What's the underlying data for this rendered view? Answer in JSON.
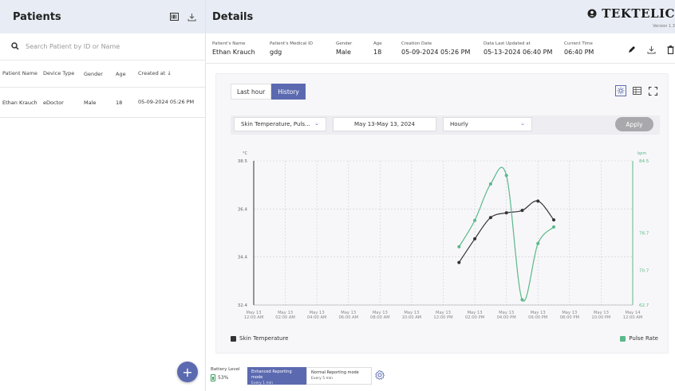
{
  "patients_panel": {
    "title": "Patients",
    "search_placeholder": "Search Patient by ID or Name",
    "columns": [
      "Patient Name",
      "Device Type",
      "Gender",
      "Age",
      "Created at ↓"
    ],
    "rows": [
      {
        "name": "Ethan Krauch",
        "device": "eDoctor",
        "gender": "Male",
        "age": "18",
        "created": "05-09-2024 05:26 PM"
      }
    ],
    "add_label": "+"
  },
  "details": {
    "title": "Details",
    "brand": "TEKTELIC",
    "version": "Version 1.3",
    "fields": [
      {
        "label": "Patient's Name",
        "value": "Ethan Krauch"
      },
      {
        "label": "Patient's Medical ID",
        "value": "gdg"
      },
      {
        "label": "Gender",
        "value": "Male"
      },
      {
        "label": "Age",
        "value": "18"
      },
      {
        "label": "Creation Date",
        "value": "05-09-2024 05:26 PM"
      },
      {
        "label": "Data Last Updated at",
        "value": "05-13-2024 06:40 PM"
      },
      {
        "label": "Current Time",
        "value": "06:40 PM"
      }
    ]
  },
  "chart_controls": {
    "tabs": [
      "Last hour",
      "History"
    ],
    "active_tab": "History",
    "metric_select": "Skin Temperature, Puls...",
    "date_range": "May 13-May 13, 2024",
    "interval_select": "Hourly",
    "apply_label": "Apply"
  },
  "bottom_bar": {
    "battery_label": "Battery Level",
    "battery_value": "53%",
    "enhanced_mode": "Enhanced Reporting mode",
    "enhanced_sub": "Every 1 min",
    "normal_mode": "Normal Reporting mode",
    "normal_sub": "Every 5 min"
  },
  "colors": {
    "accent": "#5b6ab0",
    "skin_temp": "#333333",
    "pulse": "#5bb88a"
  },
  "chart_data": {
    "type": "line",
    "x": [
      "May 13 12:00 AM",
      "May 13 02:00 AM",
      "May 13 04:00 AM",
      "May 13 06:00 AM",
      "May 13 08:00 AM",
      "May 13 10:00 AM",
      "May 13 12:00 PM",
      "May 13 02:00 PM",
      "May 13 04:00 PM",
      "May 13 06:00 PM",
      "May 13 08:00 PM",
      "May 13 10:00 PM",
      "May 14 12:00 AM"
    ],
    "left_axis": {
      "unit": "°C",
      "ticks": [
        "38.5",
        "36.4",
        "34.4",
        "32.4"
      ],
      "range": [
        32.4,
        38.5
      ]
    },
    "right_axis": {
      "unit": "bpm",
      "ticks": [
        "84.5",
        "78.7",
        "70.7",
        "62.7"
      ],
      "range": [
        62.7,
        84.5
      ]
    },
    "series": [
      {
        "name": "Skin Temperature",
        "axis": "left",
        "hours": [
          13,
          14,
          15,
          16,
          17,
          18,
          19
        ],
        "values": [
          34.2,
          35.2,
          36.1,
          36.3,
          36.4,
          36.8,
          36.0
        ]
      },
      {
        "name": "Pulse Rate",
        "axis": "right",
        "hours": [
          13,
          14,
          15,
          16,
          17,
          18,
          19
        ],
        "values": [
          71.5,
          75.5,
          81.0,
          82.3,
          63.5,
          72.0,
          74.5
        ]
      }
    ],
    "grid": true,
    "legend": "bottom"
  }
}
